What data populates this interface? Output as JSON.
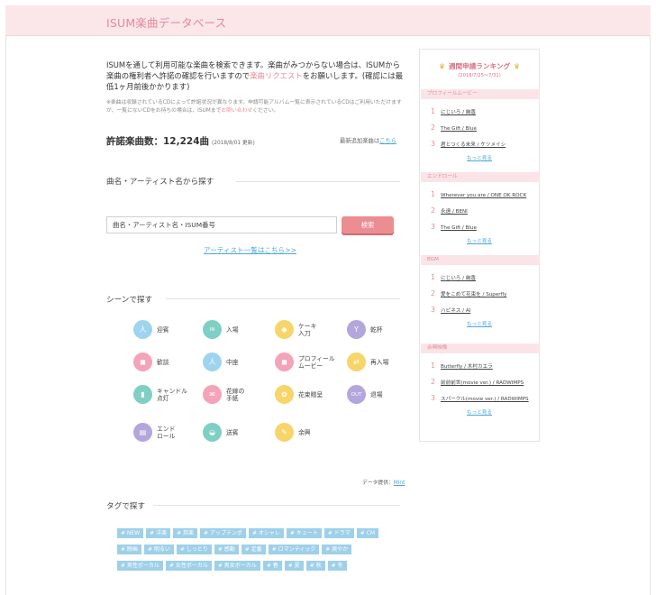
{
  "header": {
    "title": "ISUM楽曲データベース"
  },
  "intro": {
    "text_before": "ISUMを通して利用可能な楽曲を検索できます。楽曲がみつからない場合は、ISUMから楽曲の権利者へ許諾の確認を行いますので",
    "link": "楽曲リクエスト",
    "text_after": "をお願いします。(確認には最低1ヶ月前後かかります)"
  },
  "note": {
    "text_before": "※楽曲は収録されているCDによって許諾状況が異なります。申請可能アルバム一覧に表示されているCDはご利用いただけますが、一覧にないCDをお持ちの場合は、ISUMまで",
    "link": "お問い合わせ",
    "text_after": "ください。"
  },
  "count": {
    "label": "許諾楽曲数：12,224曲",
    "date": "(2018/8/01 更新)",
    "latest_label": "最新追加楽曲は",
    "latest_link": "こちら"
  },
  "search_section": {
    "title": "曲名・アーティスト名から探す",
    "placeholder": "曲名・アーティスト名・ISUM番号",
    "button": "検索",
    "artist_link": "アーティスト一覧はこちら>>"
  },
  "scene_section": {
    "title": "シーンで探す",
    "items": [
      {
        "label": "迎賓",
        "color": "#9fd4ee",
        "glyph": "人"
      },
      {
        "label": "入場",
        "color": "#7fcfc4",
        "glyph": "IN"
      },
      {
        "label": "ケーキ\n入刀",
        "color": "#f6d56a",
        "glyph": "◆"
      },
      {
        "label": "乾杯",
        "color": "#b3a6dc",
        "glyph": "Y"
      },
      {
        "label": "歓談",
        "color": "#f5a3b9",
        "glyph": "◼"
      },
      {
        "label": "中座",
        "color": "#9fd4ee",
        "glyph": "人"
      },
      {
        "label": "プロフィール\nムービー",
        "color": "#f5a3b9",
        "glyph": "◼"
      },
      {
        "label": "再入場",
        "color": "#f6d56a",
        "glyph": "⇄"
      },
      {
        "label": "キャンドル\n点灯",
        "color": "#7fcfc4",
        "glyph": "▮"
      },
      {
        "label": "花嫁の\n手紙",
        "color": "#f5a3b9",
        "glyph": "✉"
      },
      {
        "label": "花束贈呈",
        "color": "#f6d56a",
        "glyph": "✿"
      },
      {
        "label": "退場",
        "color": "#b3a6dc",
        "glyph": "OUT"
      },
      {
        "label": "エンド\nロール",
        "color": "#b3a6dc",
        "glyph": "▤"
      },
      {
        "label": "送賓",
        "color": "#7fcfc4",
        "glyph": "◒"
      },
      {
        "label": "余興",
        "color": "#f6d56a",
        "glyph": "✎"
      }
    ]
  },
  "credit": {
    "label": "データ提供：",
    "link": "Mint"
  },
  "tag_section": {
    "title": "タグで探す",
    "tags": [
      "# NEW",
      "# 洋楽",
      "# 邦楽",
      "# アップテンポ",
      "# オシャレ",
      "# キュート",
      "# ドラマ",
      "# CM",
      "# 映画",
      "# 明るい",
      "# しっとり",
      "# 感動",
      "# 定番",
      "# ロマンティック",
      "# 爽やか",
      "# 男性ボーカル",
      "# 女性ボーカル",
      "# 男女ボーカル",
      "# 春",
      "# 夏",
      "# 秋",
      "# 冬"
    ]
  },
  "ranking": {
    "title": "週間申請ランキング",
    "period": "(2018/7/25〜7/31)",
    "more_label": "もっと見る",
    "categories": [
      {
        "name": "プロフィールムービー",
        "items": [
          "にじいろ / 絢香",
          "The Gift / Blue",
          "君とつくる未来 / ケツメイシ"
        ]
      },
      {
        "name": "エンドロール",
        "items": [
          "Wherever you are / ONE OK ROCK",
          "永遠 / BENI",
          "The Gift / Blue"
        ]
      },
      {
        "name": "BGM",
        "items": [
          "にじいろ / 絢香",
          "愛をこめて花束を / Superfly",
          "ハピネス / AI"
        ]
      },
      {
        "name": "余興映像",
        "items": [
          "Butterfly / 木村カエラ",
          "前前前世(movie ver.) / RADWIMPS",
          "スパークル(movie ver.) / RADWIMPS"
        ]
      }
    ]
  }
}
